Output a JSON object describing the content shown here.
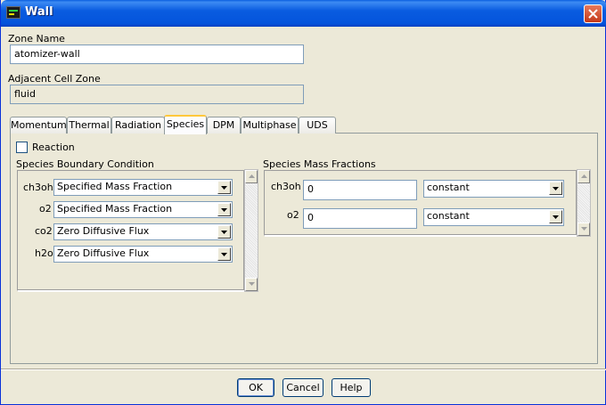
{
  "window": {
    "title": "Wall"
  },
  "zone_name": {
    "label": "Zone Name",
    "value": "atomizer-wall"
  },
  "adjacent_cell_zone": {
    "label": "Adjacent Cell Zone",
    "value": "fluid"
  },
  "tabs": [
    {
      "label": "Momentum"
    },
    {
      "label": "Thermal"
    },
    {
      "label": "Radiation"
    },
    {
      "label": "Species"
    },
    {
      "label": "DPM"
    },
    {
      "label": "Multiphase"
    },
    {
      "label": "UDS"
    }
  ],
  "reaction": {
    "label": "Reaction",
    "checked": false
  },
  "species_boundary": {
    "title": "Species Boundary Condition",
    "rows": [
      {
        "species": "ch3oh",
        "condition": "Specified Mass Fraction"
      },
      {
        "species": "o2",
        "condition": "Specified Mass Fraction"
      },
      {
        "species": "co2",
        "condition": "Zero Diffusive Flux"
      },
      {
        "species": "h2o",
        "condition": "Zero Diffusive Flux"
      }
    ]
  },
  "species_mass_fractions": {
    "title": "Species Mass Fractions",
    "rows": [
      {
        "species": "ch3oh",
        "value": "0",
        "method": "constant"
      },
      {
        "species": "o2",
        "value": "0",
        "method": "constant"
      }
    ]
  },
  "buttons": {
    "ok": "OK",
    "cancel": "Cancel",
    "help": "Help"
  },
  "icons": {
    "app": "fluent-app-icon",
    "close": "close-icon",
    "dropdown": "chevron-down-icon",
    "scroll_up": "arrow-up-icon",
    "scroll_down": "arrow-down-icon"
  },
  "colors": {
    "titlebar": "#0a5ce0",
    "window_bg": "#ece9d8",
    "tab_active_accent": "#ffc83c"
  }
}
